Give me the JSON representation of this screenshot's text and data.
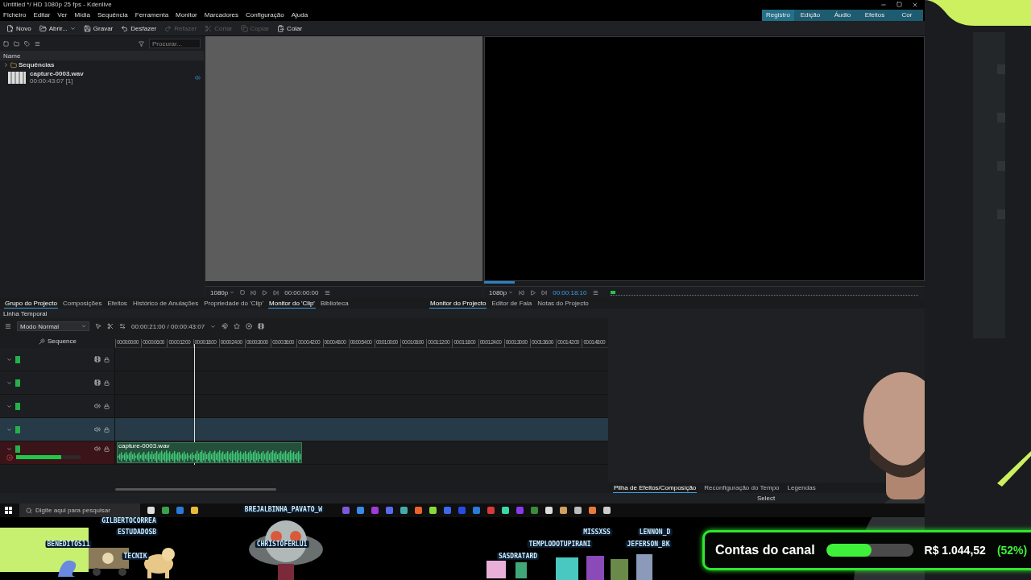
{
  "window": {
    "title": "Untitled */ HD 1080p 25 fps - Kdenlive"
  },
  "menu": [
    "Ficheiro",
    "Editar",
    "Ver",
    "Mídia",
    "Sequência",
    "Ferramenta",
    "Monitor",
    "Marcadores",
    "Configuração",
    "Ajuda"
  ],
  "layouts": [
    {
      "label": "Registro",
      "selected": true
    },
    {
      "label": "Edição",
      "selected": false
    },
    {
      "label": "Áudio",
      "selected": false
    },
    {
      "label": "Efeitos",
      "selected": false
    },
    {
      "label": "Cor",
      "selected": false
    }
  ],
  "toolbar": [
    {
      "label": "Novo",
      "disabled": false,
      "menu": false
    },
    {
      "label": "Abrir...",
      "disabled": false,
      "menu": true
    },
    {
      "label": "Gravar",
      "disabled": false,
      "menu": false
    },
    {
      "label": "Desfazer",
      "disabled": false,
      "menu": false
    },
    {
      "label": "Refazer",
      "disabled": true,
      "menu": false
    },
    {
      "label": "Cortar",
      "disabled": true,
      "menu": false
    },
    {
      "label": "Copiar",
      "disabled": true,
      "menu": false
    },
    {
      "label": "Colar",
      "disabled": false,
      "menu": false
    }
  ],
  "bin": {
    "search": {
      "placeholder": "Procurar..."
    },
    "column": "Name",
    "items": [
      {
        "kind": "folder",
        "name": "Sequências",
        "expanded": false
      },
      {
        "kind": "audio",
        "name": "capture-0003.wav",
        "duration": "00:00:43:07 [1]"
      }
    ]
  },
  "clip_monitor": {
    "resolution": "1080p",
    "timecode": "00:00:00:00"
  },
  "project_monitor": {
    "resolution": "1080p",
    "timecode": "00:00:18:10",
    "level": 0.07
  },
  "dock_tabs": [
    {
      "label": "Grupo do Projecto",
      "selected": true
    },
    {
      "label": "Composições",
      "selected": false
    },
    {
      "label": "Efeitos",
      "selected": false
    },
    {
      "label": "Histórico de Anulações",
      "selected": false
    },
    {
      "label": "Propriedade do 'Clip'",
      "selected": false
    }
  ],
  "clip_tabs": [
    {
      "label": "Monitor do 'Clip'",
      "selected": true
    },
    {
      "label": "Biblioteca",
      "selected": false
    }
  ],
  "project_tabs": [
    {
      "label": "Monitor do Projecto",
      "selected": true
    },
    {
      "label": "Editor de Fala",
      "selected": false
    },
    {
      "label": "Notas do Projecto",
      "selected": false
    }
  ],
  "timeline": {
    "title": "Linha Temporal",
    "mode": "Modo Normal",
    "timecode": "00:00:21:00 / 00:00:43:07",
    "sequence": "Sequence",
    "ruler": [
      "00:00:00:00",
      "00:00:06:00",
      "00:00:12:00",
      "00:00:18:00",
      "00:00:24:00",
      "00:00:30:00",
      "00:00:36:00",
      "00:00:42:00",
      "00:00:48:00",
      "00:00:54:00",
      "00:01:00:00",
      "00:01:06:00",
      "00:01:12:00",
      "00:01:18:00",
      "00:01:24:00",
      "00:01:30:00",
      "00:01:36:00",
      "00:01:42:00",
      "00:01:48:00"
    ],
    "playhead": {
      "level": 0.16
    },
    "tracks": [
      {
        "kind": "video",
        "selected": false,
        "recording": false
      },
      {
        "kind": "video",
        "selected": false,
        "recording": false
      },
      {
        "kind": "audio",
        "selected": false,
        "recording": false
      },
      {
        "kind": "audio",
        "selected": true,
        "recording": false
      },
      {
        "kind": "audio",
        "selected": false,
        "recording": true,
        "level": 0.7,
        "clips": [
          {
            "name": "capture-0003.wav"
          }
        ]
      }
    ]
  },
  "effect_tabs": [
    {
      "label": "Pilha de Efeitos/Composição",
      "selected": true
    },
    {
      "label": "Reconfiguração do Tempo",
      "selected": false
    },
    {
      "label": "Legendas",
      "selected": false
    }
  ],
  "status": "Select",
  "taskbar": {
    "search": {
      "placeholder": "Digite aqui para pesquisar"
    }
  },
  "chatters": [
    {
      "name": "GILBERTOCORREA"
    },
    {
      "name": "ESTUDADOSB"
    },
    {
      "name": "BENEDITOS11"
    },
    {
      "name": "TECNIK"
    },
    {
      "name": "BREJALBINHA_PAVATO_W"
    },
    {
      "name": "CHRISTOFERLU1"
    },
    {
      "name": "MISSXSS"
    },
    {
      "name": "LENNON_D"
    },
    {
      "name": "TEMPLODOTUPIRANI"
    },
    {
      "name": "JEFERSON_BK"
    },
    {
      "name": "SASDRATARD"
    }
  ],
  "goal": {
    "title": "Contas do canal",
    "level": 0.52,
    "amount": "R$ 1.044,52",
    "percent": "(52%)"
  }
}
